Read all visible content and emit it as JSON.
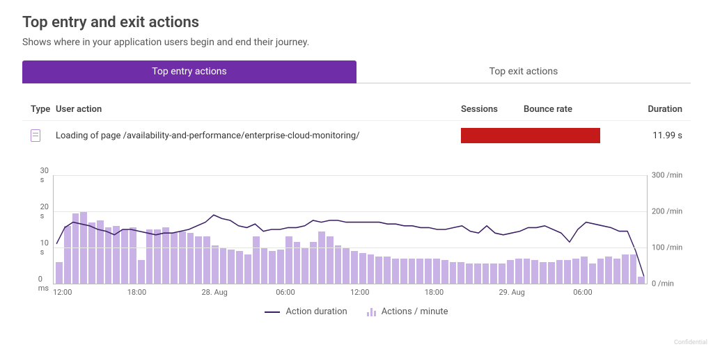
{
  "header": {
    "title": "Top entry and exit actions",
    "subtitle": "Shows where in your application users begin and end their journey."
  },
  "tabs": [
    {
      "label": "Top entry actions",
      "active": true
    },
    {
      "label": "Top exit actions",
      "active": false
    }
  ],
  "table": {
    "columns": {
      "type": "Type",
      "action": "User action",
      "sessions": "Sessions",
      "bounce": "Bounce rate",
      "duration": "Duration"
    },
    "rows": [
      {
        "icon": "page-icon",
        "action": "Loading of page /availability-and-performance/enterprise-cloud-monitoring/",
        "duration": "11.99 s"
      }
    ]
  },
  "legend": {
    "duration": "Action duration",
    "rate": "Actions / minute"
  },
  "watermark": "Confidential",
  "chart_data": {
    "type": "bar+line",
    "x_ticks": [
      "12:00",
      "18:00",
      "28. Aug",
      "06:00",
      "12:00",
      "18:00",
      "29. Aug",
      "06:00"
    ],
    "y_left": {
      "label_suffix": "",
      "ticks": [
        "0 ms",
        "10 s",
        "20 s",
        "30 s"
      ],
      "max": 30
    },
    "y_right": {
      "label_suffix": "/min",
      "ticks": [
        "0 /min",
        "100 /min",
        "200 /min",
        "300 /min"
      ],
      "max": 300
    },
    "series": [
      {
        "name": "Actions / minute",
        "axis": "right",
        "style": "bar",
        "values": [
          60,
          160,
          195,
          200,
          170,
          175,
          155,
          160,
          150,
          155,
          65,
          150,
          150,
          155,
          140,
          145,
          140,
          130,
          130,
          105,
          100,
          95,
          90,
          80,
          130,
          100,
          90,
          95,
          130,
          115,
          100,
          115,
          145,
          130,
          105,
          100,
          90,
          85,
          80,
          75,
          75,
          70,
          70,
          70,
          70,
          70,
          70,
          65,
          60,
          60,
          55,
          55,
          55,
          55,
          55,
          65,
          70,
          70,
          65,
          60,
          60,
          65,
          65,
          70,
          75,
          55,
          70,
          75,
          70,
          80,
          80,
          20
        ]
      },
      {
        "name": "Action duration",
        "axis": "left",
        "style": "line",
        "unit": "s",
        "values": [
          11,
          15.5,
          17,
          16.5,
          16,
          15,
          14.5,
          13.5,
          15,
          15,
          14.5,
          14,
          13.5,
          14,
          14,
          14.5,
          15,
          16,
          17,
          19,
          18,
          17.5,
          16,
          15.5,
          16.5,
          14.5,
          15,
          15,
          15.5,
          15.5,
          16,
          17.5,
          17,
          17.5,
          17.5,
          17,
          17,
          17,
          17,
          17,
          16.5,
          16.5,
          16,
          16,
          15.5,
          15.5,
          15,
          15,
          15.5,
          16,
          14.5,
          14,
          16,
          14,
          13.5,
          14,
          14.5,
          15.5,
          15.5,
          16,
          15,
          14,
          11.5,
          15,
          17,
          16.5,
          16,
          15.5,
          14.5,
          14.5,
          9,
          2
        ]
      }
    ]
  }
}
